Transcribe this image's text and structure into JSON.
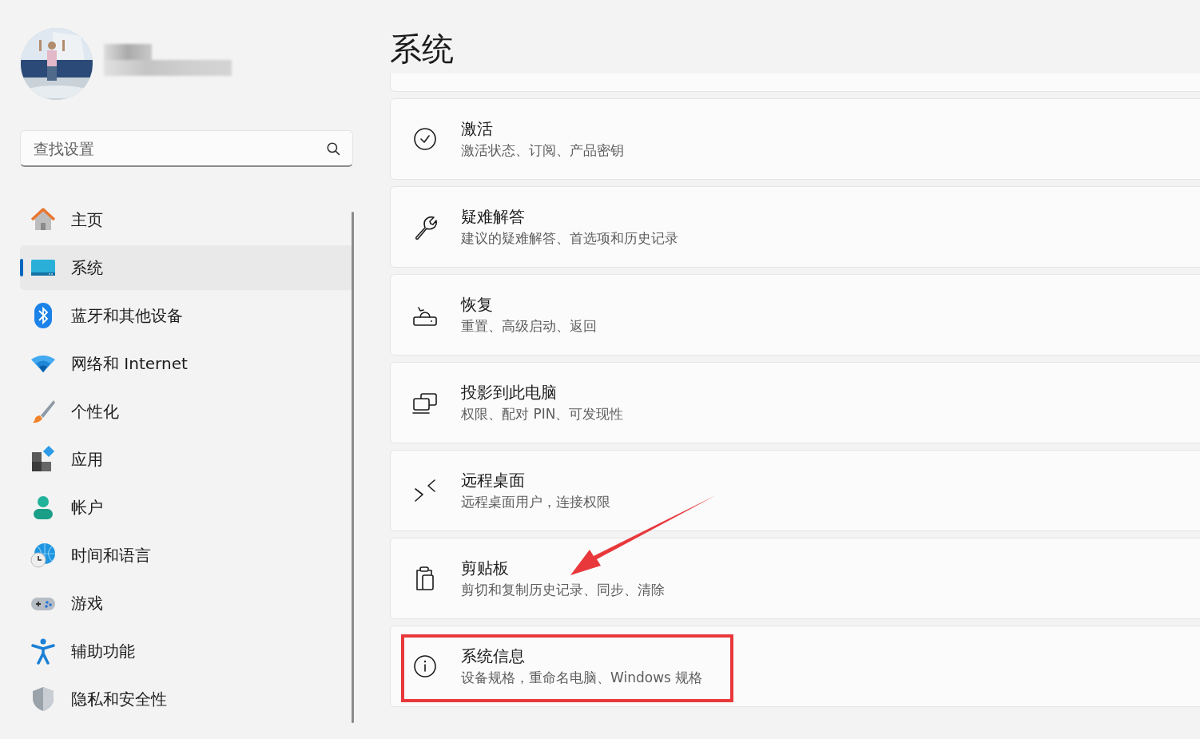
{
  "search": {
    "placeholder": "查找设置"
  },
  "sidebar": {
    "items": [
      {
        "label": "主页",
        "selected": false
      },
      {
        "label": "系统",
        "selected": true
      },
      {
        "label": "蓝牙和其他设备",
        "selected": false
      },
      {
        "label": "网络和 Internet",
        "selected": false
      },
      {
        "label": "个性化",
        "selected": false
      },
      {
        "label": "应用",
        "selected": false
      },
      {
        "label": "帐户",
        "selected": false
      },
      {
        "label": "时间和语言",
        "selected": false
      },
      {
        "label": "游戏",
        "selected": false
      },
      {
        "label": "辅助功能",
        "selected": false
      },
      {
        "label": "隐私和安全性",
        "selected": false
      }
    ]
  },
  "page": {
    "title": "系统",
    "cards": [
      {
        "title": "激活",
        "subtitle": "激活状态、订阅、产品密钥",
        "highlighted": false
      },
      {
        "title": "疑难解答",
        "subtitle": "建议的疑难解答、首选项和历史记录",
        "highlighted": false
      },
      {
        "title": "恢复",
        "subtitle": "重置、高级启动、返回",
        "highlighted": false
      },
      {
        "title": "投影到此电脑",
        "subtitle": "权限、配对 PIN、可发现性",
        "highlighted": false
      },
      {
        "title": "远程桌面",
        "subtitle": "远程桌面用户，连接权限",
        "highlighted": false
      },
      {
        "title": "剪贴板",
        "subtitle": "剪切和复制历史记录、同步、清除",
        "highlighted": false
      },
      {
        "title": "系统信息",
        "subtitle": "设备规格，重命名电脑、Windows 规格",
        "highlighted": true
      }
    ]
  }
}
